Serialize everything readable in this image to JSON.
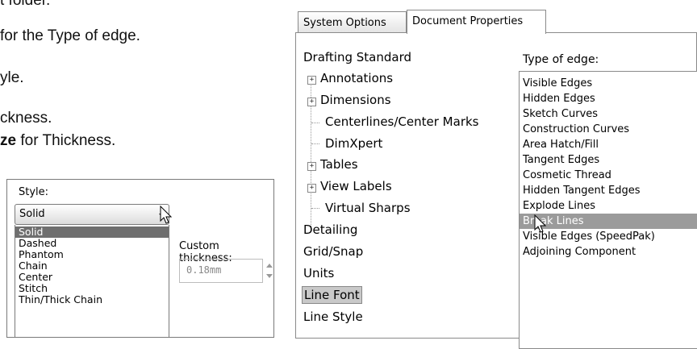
{
  "doc_text": {
    "line1": "t folder.",
    "line2": "for the Type of edge.",
    "line3": "yle.",
    "line4": "ckness.",
    "line5_bold": "ze",
    "line5_rest": " for Thickness."
  },
  "style_panel": {
    "label": "Style:",
    "selected": "Solid",
    "options": [
      "Solid",
      "Dashed",
      "Phantom",
      "Chain",
      "Center",
      "Stitch",
      "Thin/Thick Chain"
    ],
    "highlighted_option": "Solid",
    "thickness_label": "Custom thickness:",
    "thickness_value": "0.18mm"
  },
  "dialog": {
    "tabs": [
      "System Options",
      "Document Properties"
    ],
    "active_tab": "Document Properties",
    "tree": [
      {
        "label": "Drafting Standard",
        "level": 0,
        "expander": false
      },
      {
        "label": "Annotations",
        "level": 1,
        "expander": true
      },
      {
        "label": "Dimensions",
        "level": 1,
        "expander": true
      },
      {
        "label": "Centerlines/Center Marks",
        "level": 1,
        "expander": false
      },
      {
        "label": "DimXpert",
        "level": 1,
        "expander": false
      },
      {
        "label": "Tables",
        "level": 1,
        "expander": true
      },
      {
        "label": "View Labels",
        "level": 1,
        "expander": true
      },
      {
        "label": "Virtual Sharps",
        "level": 1,
        "expander": false
      },
      {
        "label": "Detailing",
        "level": 0,
        "expander": false
      },
      {
        "label": "Grid/Snap",
        "level": 0,
        "expander": false
      },
      {
        "label": "Units",
        "level": 0,
        "expander": false
      },
      {
        "label": "Line Font",
        "level": 0,
        "expander": false,
        "selected": true
      },
      {
        "label": "Line Style",
        "level": 0,
        "expander": false
      }
    ],
    "edge_label": "Type of edge:",
    "edge_types": [
      "Visible Edges",
      "Hidden Edges",
      "Sketch Curves",
      "Construction Curves",
      "Area Hatch/Fill",
      "Tangent Edges",
      "Cosmetic Thread",
      "Hidden Tangent Edges",
      "Explode Lines",
      "Break Lines",
      "Visible Edges (SpeedPak)",
      "Adjoining Component"
    ],
    "edge_selected": "Break Lines"
  }
}
